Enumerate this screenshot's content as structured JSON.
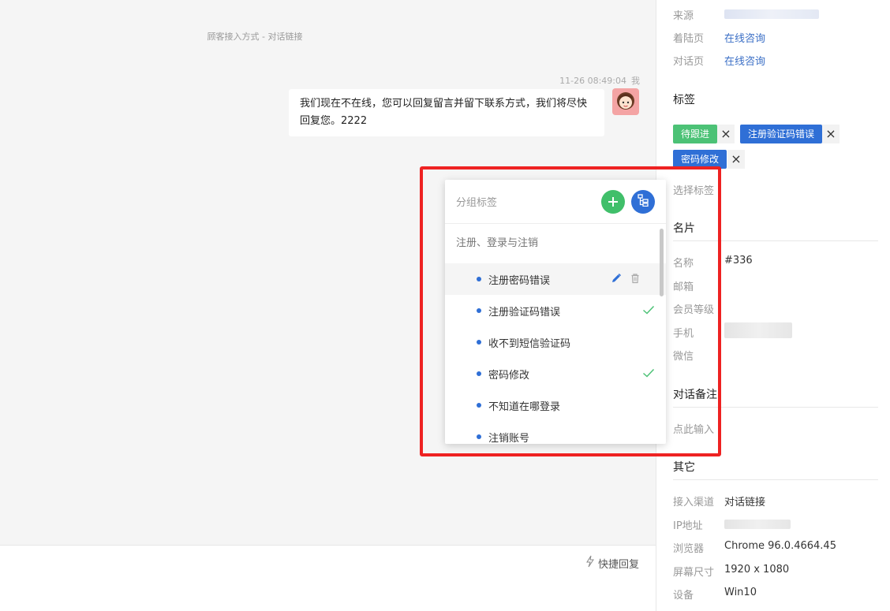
{
  "chat": {
    "system_line": "顾客接入方式 - 对话链接",
    "message": {
      "time": "11-26 08:49:04",
      "sender": "我",
      "text": "我们现在不在线，您可以回复留言并留下联系方式，我们将尽快回复您。2222"
    }
  },
  "composer": {
    "quick_reply": "快捷回复"
  },
  "panel": {
    "source_label": "来源",
    "landing_label": "着陆页",
    "landing_value": "在线咨询",
    "chat_page_label": "对话页",
    "chat_page_value": "在线咨询",
    "tags_title": "标签",
    "tags": [
      "待跟进",
      "注册验证码错误",
      "密码修改"
    ],
    "select_tags": "选择标签",
    "card_title": "名片",
    "card": {
      "name_label": "名称",
      "name_value": "#336",
      "email_label": "邮箱",
      "level_label": "会员等级",
      "phone_label": "手机",
      "wechat_label": "微信"
    },
    "notes_title": "对话备注",
    "notes_placeholder": "点此输入",
    "other_title": "其它",
    "other": {
      "channel_label": "接入渠道",
      "channel_value": "对话链接",
      "ip_label": "IP地址",
      "browser_label": "浏览器",
      "browser_value": "Chrome 96.0.4664.45",
      "screen_label": "屏幕尺寸",
      "screen_value": "1920 x 1080",
      "device_label": "设备",
      "device_value": "Win10"
    }
  },
  "dropdown": {
    "title": "分组标签",
    "group": "注册、登录与注销",
    "items": [
      {
        "label": "注册密码错误",
        "checked": false,
        "hover": true
      },
      {
        "label": "注册验证码错误",
        "checked": true
      },
      {
        "label": "收不到短信验证码",
        "checked": false
      },
      {
        "label": "密码修改",
        "checked": true
      },
      {
        "label": "不知道在哪登录",
        "checked": false
      },
      {
        "label": "注销账号",
        "checked": false
      }
    ]
  },
  "colors": {
    "accent_blue": "#2f6fd6",
    "accent_green": "#4cc276",
    "highlight_red": "#ee2222"
  },
  "icons": [
    "user-avatar-icon",
    "lightning-icon",
    "close-icon",
    "plus-icon",
    "tree-icon",
    "edit-icon",
    "trash-icon",
    "check-icon"
  ]
}
